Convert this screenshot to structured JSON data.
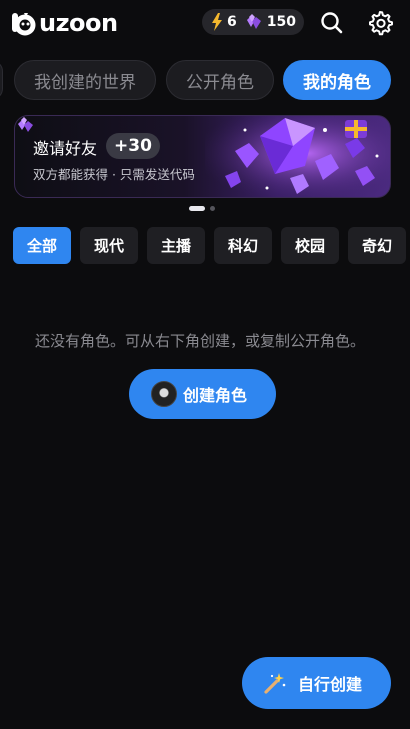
{
  "header": {
    "logo_text": "uzoon",
    "energy_count": "6",
    "gem_count": "150",
    "icons": {
      "search": "search-icon",
      "settings": "gear-icon",
      "energy": "lightning-icon",
      "gems": "gem-icon"
    }
  },
  "tabs": [
    {
      "label": "我创建的世界"
    },
    {
      "label": "公开角色"
    },
    {
      "label": "我的角色"
    }
  ],
  "active_tab": "我的角色",
  "banner": {
    "title": "邀请好友",
    "badge": "+30",
    "subtitle": "双方都能获得 · 只需发送代码",
    "slide_index": "1",
    "slide_count": "2"
  },
  "genres": [
    {
      "label": "全部"
    },
    {
      "label": "现代"
    },
    {
      "label": "主播"
    },
    {
      "label": "科幻"
    },
    {
      "label": "校园"
    },
    {
      "label": "奇幻"
    }
  ],
  "active_genre": "全部",
  "empty_state": {
    "message": "还没有角色。可从右下角创建，或复制公开角色。",
    "button_label": "创建角色"
  },
  "fab": {
    "label": "自行创建",
    "icon": "magic-wand-icon"
  },
  "colors": {
    "accent": "#2f86f0",
    "background": "#0c0c0e",
    "chip": "#1f1f23",
    "gem": "#9b5cf0",
    "energy": "#f5b82e"
  }
}
